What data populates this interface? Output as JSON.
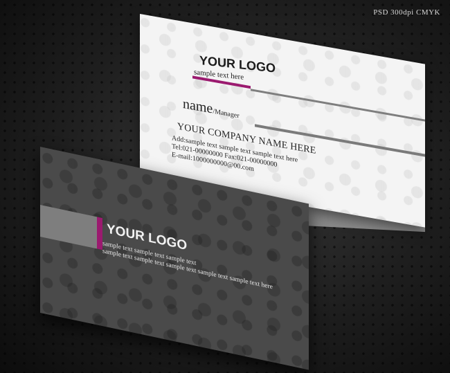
{
  "badge": "PSD 300dpi CMYK",
  "white_card": {
    "logo": "YOUR LOGO",
    "logo_sub": "sample text here",
    "name": "name",
    "title": "/Manager",
    "company": "YOUR COMPANY NAME HERE",
    "address": "Add:sample text sample text sample text here",
    "tel_fax": "Tel:021-00000000  Fax:021-00000000",
    "email": "E-mail:1000000000@00.com",
    "accent_color": "#9b1a6f"
  },
  "dark_card": {
    "logo": "YOUR LOGO",
    "line1": "sample text sample text sample text",
    "line2": "sample text sample text sample text sample text sample text here",
    "accent_color": "#9b1a6f"
  }
}
